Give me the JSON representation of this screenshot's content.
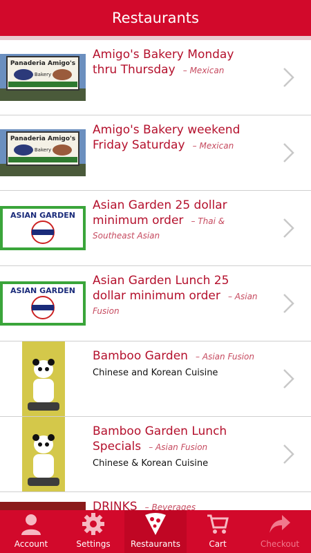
{
  "header": {
    "title": "Restaurants"
  },
  "restaurants": [
    {
      "name": "Amigo's Bakery Monday thru Thursday",
      "cuisine": "Mexican",
      "description": "",
      "image": "panaderia-amigos-sign"
    },
    {
      "name": "Amigo's Bakery weekend Friday Saturday",
      "cuisine": "Mexican",
      "description": "",
      "image": "panaderia-amigos-sign"
    },
    {
      "name": "Asian Garden 25 dollar minimum order",
      "cuisine": "Thai & Southeast Asian",
      "description": "",
      "image": "asian-garden-logo"
    },
    {
      "name": "Asian Garden Lunch 25 dollar minimum order",
      "cuisine": "Asian Fusion",
      "description": "",
      "image": "asian-garden-logo"
    },
    {
      "name": "Bamboo Garden",
      "cuisine": "Asian Fusion",
      "description": "Chinese and Korean Cuisine",
      "image": "bamboo-garden-panda"
    },
    {
      "name": "Bamboo Garden Lunch Specials",
      "cuisine": "Asian Fusion",
      "description": "Chinese & Korean Cuisine",
      "image": "bamboo-garden-panda"
    },
    {
      "name": "DRINKS",
      "cuisine": "Beverages",
      "description": "",
      "image": "drinks"
    }
  ],
  "separator": "–",
  "tabs": [
    {
      "label": "Account",
      "icon": "person-icon",
      "active": false,
      "enabled": true
    },
    {
      "label": "Settings",
      "icon": "gear-icon",
      "active": false,
      "enabled": true
    },
    {
      "label": "Restaurants",
      "icon": "pizza-slice-icon",
      "active": true,
      "enabled": true
    },
    {
      "label": "Cart",
      "icon": "cart-icon",
      "active": false,
      "enabled": true
    },
    {
      "label": "Checkout",
      "icon": "arrow-forward-icon",
      "active": false,
      "enabled": false
    }
  ],
  "colors": {
    "brand": "#d2092b",
    "title_text": "#b4102c"
  }
}
